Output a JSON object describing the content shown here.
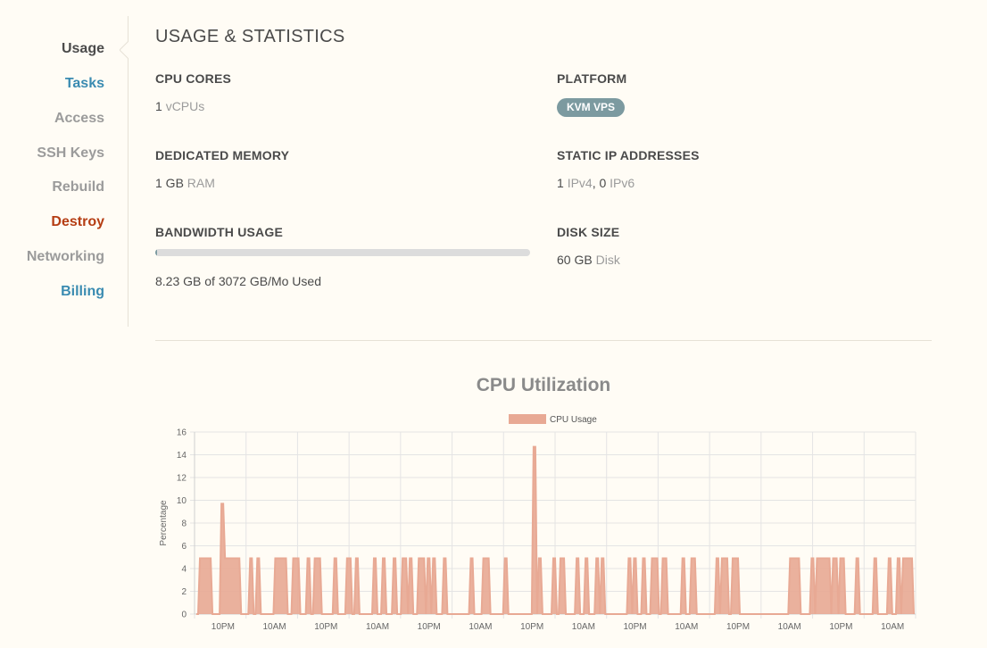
{
  "sidebar": {
    "items": [
      {
        "label": "Usage",
        "style": "active"
      },
      {
        "label": "Tasks",
        "style": "link-blue"
      },
      {
        "label": "Access",
        "style": "muted"
      },
      {
        "label": "SSH Keys",
        "style": "muted"
      },
      {
        "label": "Rebuild",
        "style": "muted"
      },
      {
        "label": "Destroy",
        "style": "danger"
      },
      {
        "label": "Networking",
        "style": "muted"
      },
      {
        "label": "Billing",
        "style": "link-blue"
      }
    ]
  },
  "main": {
    "title": "USAGE & STATISTICS",
    "cpu": {
      "label": "CPU CORES",
      "value": "1",
      "unit": "vCPUs"
    },
    "platform": {
      "label": "PLATFORM",
      "badge": "KVM VPS"
    },
    "memory": {
      "label": "DEDICATED MEMORY",
      "value": "1 GB",
      "unit": "RAM"
    },
    "ips": {
      "label": "STATIC IP ADDRESSES",
      "ipv4_value": "1",
      "ipv4_unit": "IPv4",
      "sep": ",",
      "ipv6_value": "0",
      "ipv6_unit": "IPv6"
    },
    "bandwidth": {
      "label": "BANDWIDTH USAGE",
      "text": "8.23 GB of 3072 GB/Mo Used",
      "used_gb": 8.23,
      "total_gb": 3072
    },
    "disk": {
      "label": "DISK SIZE",
      "value": "60 GB",
      "unit": "Disk"
    }
  },
  "colors": {
    "accent": "#3a8bb1",
    "danger": "#b53d13",
    "badge": "#7c9aa0",
    "series": "#e8a994"
  },
  "chart_data": {
    "type": "area",
    "title": "CPU Utilization",
    "xlabel": "",
    "ylabel": "Percentage",
    "ylim": [
      0,
      16
    ],
    "yticks": [
      0,
      2,
      4,
      6,
      8,
      10,
      12,
      14,
      16
    ],
    "xtick_labels": [
      "10PM",
      "10AM",
      "10PM",
      "10AM",
      "10PM",
      "10AM",
      "10PM",
      "10AM",
      "10PM",
      "10AM",
      "10PM",
      "10AM",
      "10PM",
      "10AM"
    ],
    "legend": {
      "position": "top-center"
    },
    "grid": true,
    "series": [
      {
        "name": "CPU Usage",
        "color": "#e8a994",
        "samples": 400,
        "spikes": [
          [
            2,
            8,
            4.9
          ],
          [
            14,
            15,
            9.7
          ],
          [
            15,
            24,
            4.9
          ],
          [
            30,
            31,
            4.9
          ],
          [
            34,
            35,
            4.9
          ],
          [
            44,
            45,
            4.9
          ],
          [
            46,
            50,
            4.9
          ],
          [
            54,
            57,
            4.9
          ],
          [
            62,
            63,
            4.9
          ],
          [
            66,
            69,
            4.9
          ],
          [
            77,
            78,
            4.9
          ],
          [
            84,
            86,
            4.9
          ],
          [
            89,
            90,
            4.9
          ],
          [
            99,
            100,
            4.9
          ],
          [
            104,
            105,
            4.9
          ],
          [
            110,
            111,
            4.9
          ],
          [
            115,
            117,
            4.9
          ],
          [
            119,
            120,
            4.9
          ],
          [
            124,
            127,
            4.9
          ],
          [
            129,
            130,
            4.9
          ],
          [
            132,
            133,
            4.9
          ],
          [
            138,
            139,
            4.9
          ],
          [
            153,
            154,
            4.9
          ],
          [
            160,
            163,
            4.9
          ],
          [
            172,
            173,
            4.9
          ],
          [
            188,
            189,
            14.7
          ],
          [
            191,
            192,
            4.9
          ],
          [
            199,
            200,
            4.9
          ],
          [
            203,
            205,
            4.9
          ],
          [
            212,
            213,
            4.9
          ],
          [
            217,
            218,
            4.9
          ],
          [
            223,
            224,
            4.9
          ],
          [
            226,
            227,
            4.9
          ],
          [
            241,
            242,
            4.9
          ],
          [
            244,
            245,
            4.9
          ],
          [
            249,
            250,
            4.9
          ],
          [
            254,
            255,
            4.9
          ],
          [
            256,
            257,
            4.9
          ],
          [
            260,
            262,
            4.9
          ],
          [
            271,
            272,
            4.9
          ],
          [
            276,
            278,
            4.9
          ],
          [
            290,
            291,
            4.9
          ],
          [
            293,
            296,
            4.9
          ],
          [
            299,
            302,
            4.9
          ],
          [
            331,
            336,
            4.9
          ],
          [
            343,
            344,
            4.9
          ],
          [
            346,
            353,
            4.9
          ],
          [
            355,
            357,
            4.9
          ],
          [
            359,
            361,
            4.9
          ],
          [
            368,
            369,
            4.9
          ],
          [
            378,
            379,
            4.9
          ],
          [
            386,
            387,
            4.9
          ],
          [
            391,
            392,
            4.9
          ],
          [
            394,
            396,
            4.9
          ],
          [
            397,
            399,
            4.9
          ]
        ]
      }
    ]
  }
}
